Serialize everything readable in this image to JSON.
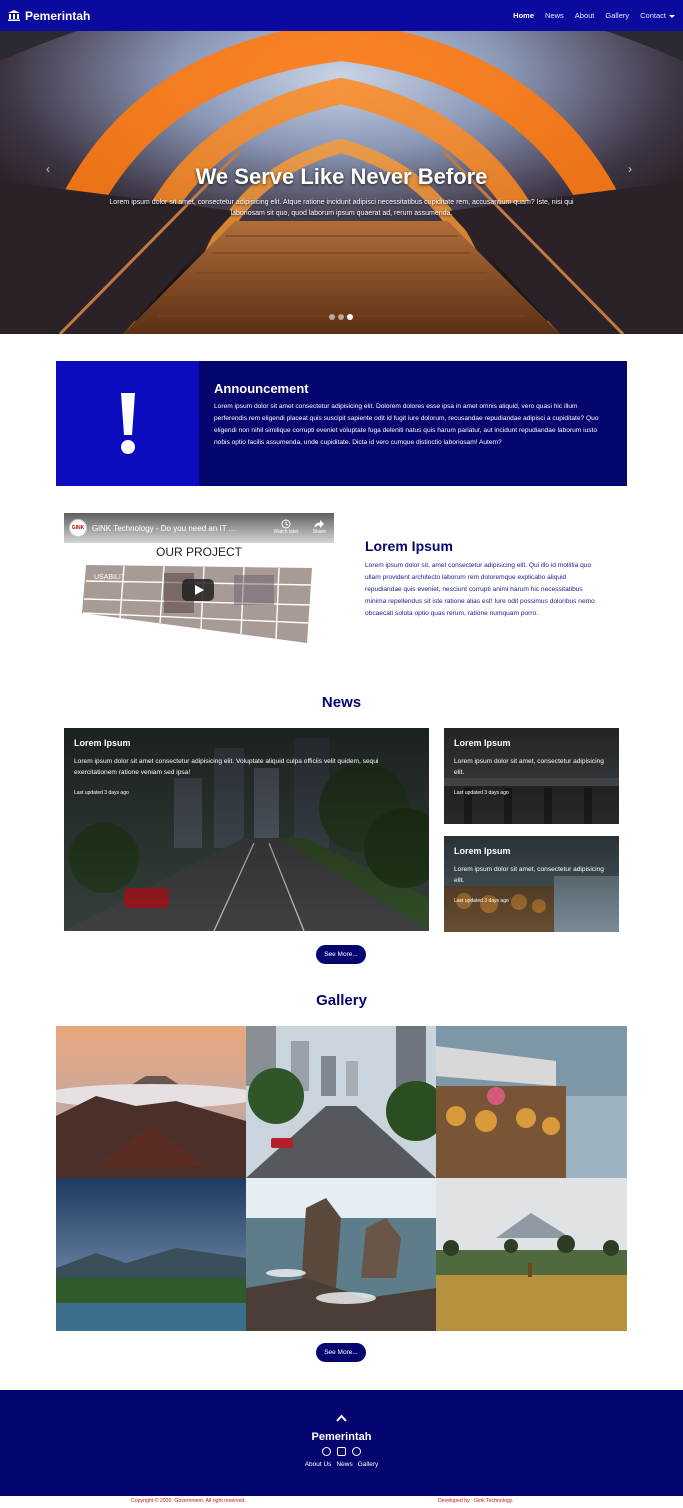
{
  "navbar": {
    "brand": "Pemerintah",
    "brand_icon": "bank-icon",
    "links": [
      "Home",
      "News",
      "About",
      "Gallery",
      "Contact"
    ]
  },
  "hero": {
    "title": "We Serve Like Never Before",
    "text": "Lorem ipsum dolor sit amet, consectetur adipisicing elit. Atque ratione incidunt adipisci necessitatibus cupiditate rem, accusantium quam? Iste, nisi qui laboriosam sit quo, quod laborum ipsum quaerat ad, rerum assumenda.",
    "slide_count": 3,
    "active_slide": 3
  },
  "announcement": {
    "title": "Announcement",
    "text": "Lorem ipsum dolor sit amet consectetur adipisicing elit. Dolorem dolores esse ipsa in amet omnis aliquid, vero quasi hic illum perferendis rem eligendi placeat quis suscipit sapiente odit id fugit iure dolorum, recusandae repudiandae adipisci a cupiditate? Quo eligendi non nihil similique corrupti eveniet voluptate fuga deleniti natus quis harum pariatur, aut incidunt repudiandae laborum iusto nobis optio facilis assumenda, unde cupiditate. Dicta id vero cumque distinctio laboriosam! Autem?"
  },
  "video": {
    "channel_label": "GINK",
    "title": "GiNK Technology - Do you need an IT ...",
    "watch_later": "Watch later",
    "share": "Share",
    "caption": "OUR PROJECT"
  },
  "project": {
    "title": "Lorem Ipsum",
    "text": "Lorem ipsum dolor sit, amet consectetur adipisicing elit. Qui illo id mollitia quo ullam provident architecto laborum rem doloremque explicabo aliquid repudiandae quis eveniet, nesciunt corrupti animi harum hic necessitatibus minima repellendus sit iste ratione alias est! Iure odit possimus doloribus nemo obcaecati soluta optio quas rerum, ratione numquam porro."
  },
  "news": {
    "title": "News",
    "cards": [
      {
        "title": "Lorem Ipsum",
        "text": "Lorem ipsum dolor sit amet consectetur adipisicing elit. Voluptate aliquid culpa officiis velit quidem, sequi exercitationem ratione veniam sed ipsa!",
        "updated": "Last updated 3 days ago"
      },
      {
        "title": "Lorem Ipsum",
        "text": "Lorem ipsum dolor sit amet, consectetur adipisicing elit.",
        "updated": "Last updated 3 days ago"
      },
      {
        "title": "Lorem Ipsum",
        "text": "Lorem ipsum dolor sit amet, consectetur adipisicing elit.",
        "updated": "Last updated 3 days ago"
      }
    ],
    "more_label": "See More..."
  },
  "gallery": {
    "title": "Gallery",
    "more_label": "See More..."
  },
  "footer": {
    "brand": "Pemerintah",
    "social_icons": [
      "whatsapp-icon",
      "instagram-icon",
      "dribbble-icon"
    ],
    "links": [
      "About Us",
      "News",
      "Gallery"
    ],
    "copyright": "Copyright © 2020. Government. All right reserved.",
    "developer": "Developed by : Gink Technology."
  },
  "colors": {
    "navbar": "#0a0a9e",
    "primary_dark": "#05056f",
    "announce_icon_bg": "#0c0cbf",
    "copyright_text": "#d01010"
  }
}
